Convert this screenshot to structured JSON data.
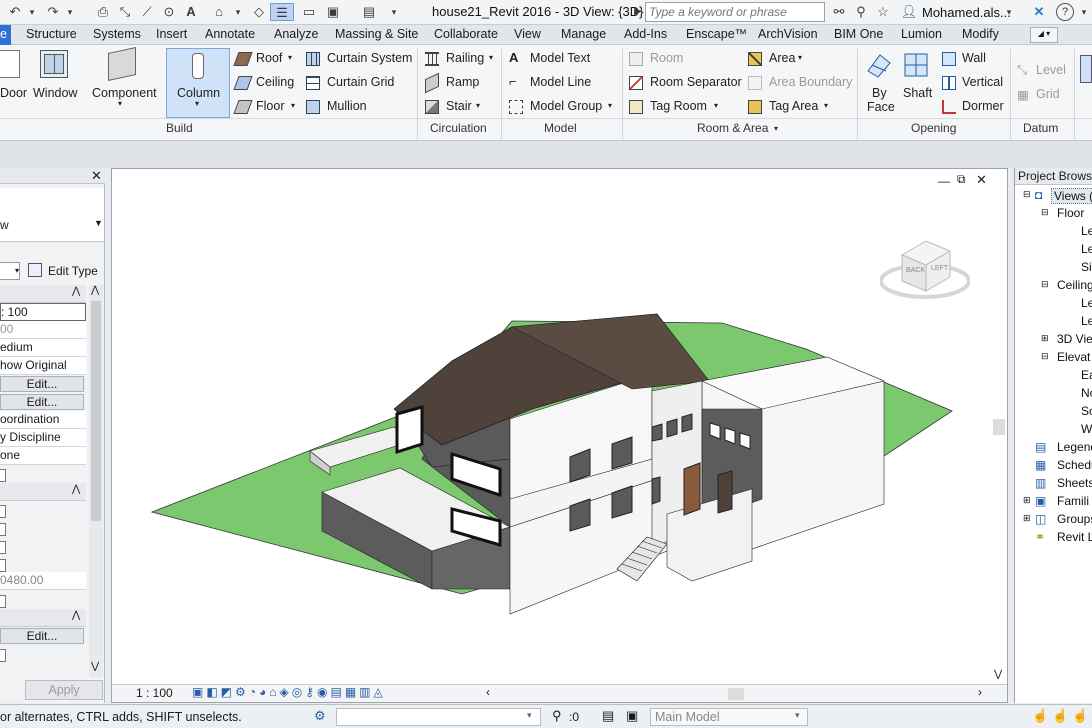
{
  "titlebar": {
    "document_title": "house21_Revit 2016 - 3D View: {3D}",
    "search_placeholder": "Type a keyword or phrase",
    "user_name": "Mohamed.als..."
  },
  "tabs": [
    "e",
    "Structure",
    "Systems",
    "Insert",
    "Annotate",
    "Analyze",
    "Massing & Site",
    "Collaborate",
    "View",
    "Manage",
    "Add-Ins",
    "Enscape™",
    "ArchVision",
    "BIM One",
    "Lumion",
    "Modify"
  ],
  "ribbon": {
    "build": {
      "title": "Build",
      "door": "Door",
      "window": "Window",
      "component": "Component",
      "column": "Column",
      "roof": "Roof",
      "ceiling": "Ceiling",
      "floor": "Floor",
      "curtain_system": "Curtain System",
      "curtain_grid": "Curtain Grid",
      "mullion": "Mullion"
    },
    "circulation": {
      "title": "Circulation",
      "railing": "Railing",
      "ramp": "Ramp",
      "stair": "Stair"
    },
    "model": {
      "title": "Model",
      "model_text": "Model  Text",
      "model_line": "Model  Line",
      "model_group": "Model  Group"
    },
    "room_area": {
      "title": "Room & Area",
      "room": "Room",
      "room_separator": "Room  Separator",
      "tag_room": "Tag  Room",
      "area": "Area",
      "area_boundary": "Area  Boundary",
      "tag_area": "Tag  Area"
    },
    "opening": {
      "title": "Opening",
      "by_face_1": "By",
      "by_face_2": "Face",
      "shaft": "Shaft",
      "wall": "Wall",
      "vertical": "Vertical",
      "dormer": "Dormer"
    },
    "datum": {
      "title": "Datum",
      "level": "Level",
      "grid": "Grid"
    }
  },
  "properties": {
    "type_value": "w",
    "edit_type": "Edit Type",
    "scale": ": 100",
    "scale_value": "00",
    "detail": "edium",
    "parts": "how Original",
    "edit1": "Edit...",
    "edit2": "Edit...",
    "discipline": "oordination",
    "show_hidden": "y Discipline",
    "default_analysis": "one",
    "eye_elevation": "0480.00",
    "edit3": "Edit...",
    "apply": "Apply"
  },
  "viewport": {
    "scale": "1 : 100",
    "viewcube_back": "BACK",
    "viewcube_left": "LEFT"
  },
  "browser": {
    "title": "Project Browse",
    "items": [
      "Views (",
      "Floor",
      "Le",
      "Le",
      "Si",
      "Ceiling",
      "Le",
      "Le",
      "3D Vie",
      "Elevat",
      "Ea",
      "No",
      "So",
      "W",
      "Legend",
      "Schedu",
      "Sheets",
      "Famili",
      "Groups",
      "Revit L"
    ]
  },
  "statusbar": {
    "hint": "or alternates, CTRL adds, SHIFT unselects.",
    "filter_count": ":0",
    "workset": "Main Model"
  },
  "colors": {
    "accent": "#2f6fd6",
    "roof": "#4f423a",
    "grass": "#7cc86e",
    "wall": "#f4f4f4",
    "wall_shade": "#5c5c5c"
  }
}
